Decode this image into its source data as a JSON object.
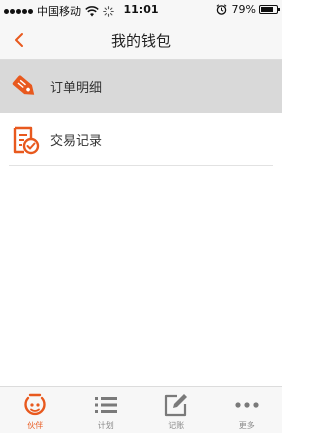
{
  "colors": {
    "accent": "#e8591e",
    "selected_row": "#d9d9d9",
    "inactive_icon": "#7a7a7a"
  },
  "status_bar": {
    "carrier": "中国移动",
    "time": "11:01",
    "battery": "79%",
    "battery_level": 0.79,
    "icons": [
      "signal-dots-icon",
      "wifi-icon",
      "loading-icon",
      "alarm-icon",
      "battery-icon"
    ]
  },
  "nav": {
    "back_icon": "chevron-left-icon",
    "title": "我的钱包"
  },
  "menu": {
    "items": [
      {
        "label": "订单明细",
        "icon": "price-tag-icon",
        "selected": true
      },
      {
        "label": "交易记录",
        "icon": "document-check-icon",
        "selected": false
      }
    ]
  },
  "tab_bar": {
    "tabs": [
      {
        "label": "伙伴",
        "icon": "partner-face-icon",
        "active": true
      },
      {
        "label": "计划",
        "icon": "list-icon",
        "active": false
      },
      {
        "label": "记账",
        "icon": "edit-note-icon",
        "active": false
      },
      {
        "label": "更多",
        "icon": "more-dots-icon",
        "active": false
      }
    ]
  }
}
